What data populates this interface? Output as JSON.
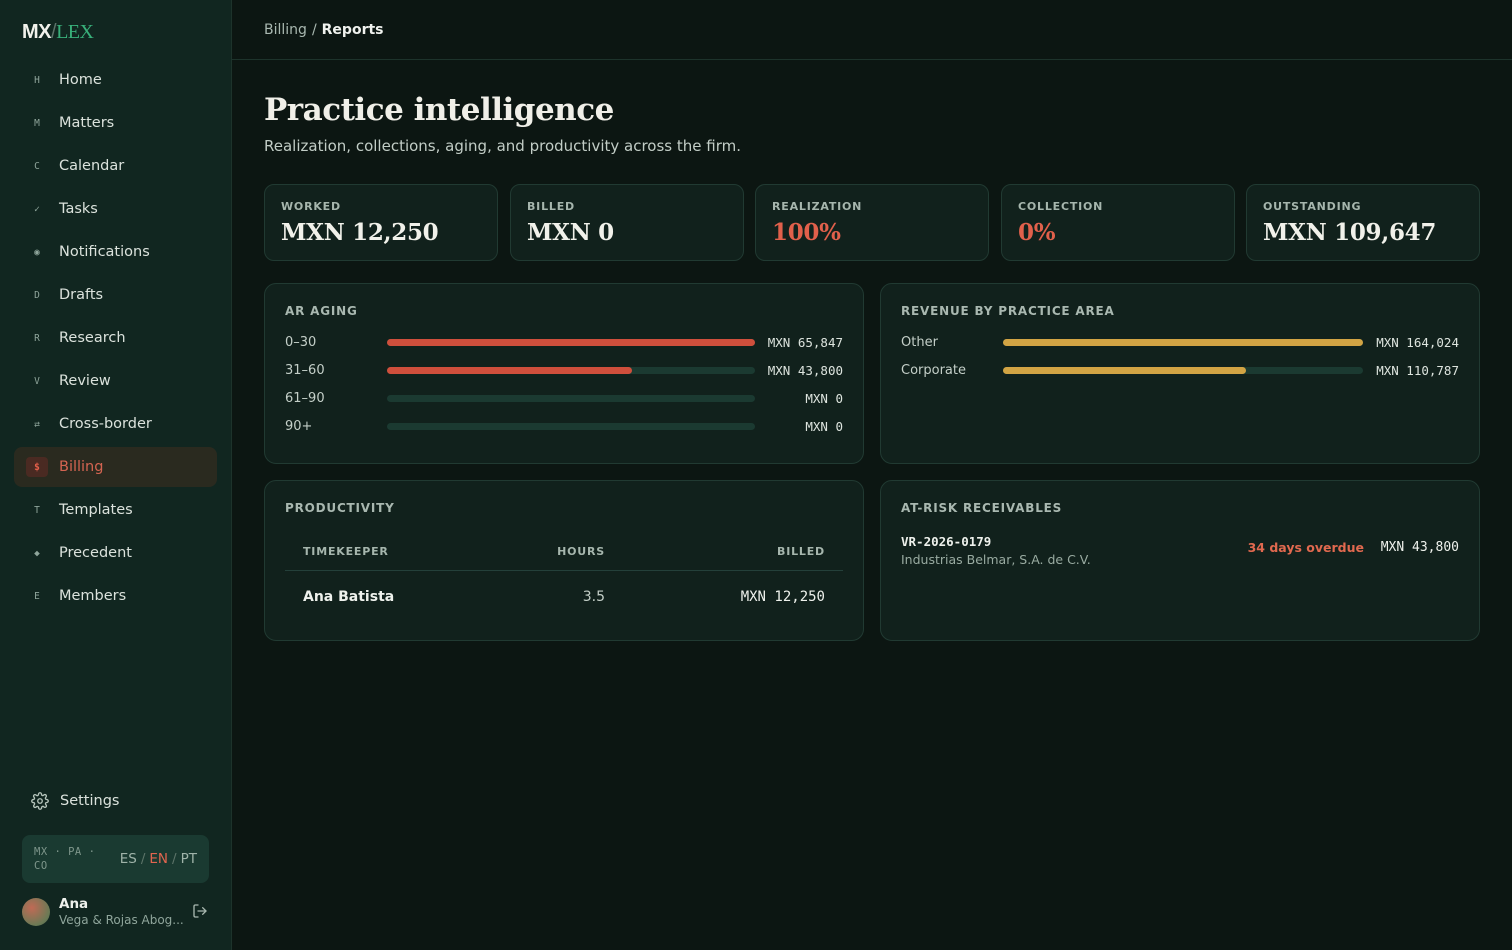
{
  "brand": {
    "mx": "MX",
    "slash": "/",
    "lex": "LEX"
  },
  "nav": [
    {
      "glyph": "H",
      "label": "Home",
      "icon": "home-icon"
    },
    {
      "glyph": "M",
      "label": "Matters",
      "icon": "matters-icon"
    },
    {
      "glyph": "C",
      "label": "Calendar",
      "icon": "calendar-icon"
    },
    {
      "glyph": "✓",
      "label": "Tasks",
      "icon": "check-icon"
    },
    {
      "glyph": "◉",
      "label": "Notifications",
      "icon": "bell-icon"
    },
    {
      "glyph": "D",
      "label": "Drafts",
      "icon": "drafts-icon"
    },
    {
      "glyph": "R",
      "label": "Research",
      "icon": "research-icon"
    },
    {
      "glyph": "V",
      "label": "Review",
      "icon": "review-icon"
    },
    {
      "glyph": "⇄",
      "label": "Cross-border",
      "icon": "swap-icon"
    },
    {
      "glyph": "$",
      "label": "Billing",
      "icon": "dollar-icon",
      "active": true
    },
    {
      "glyph": "T",
      "label": "Templates",
      "icon": "templates-icon"
    },
    {
      "glyph": "◆",
      "label": "Precedent",
      "icon": "diamond-icon"
    },
    {
      "glyph": "E",
      "label": "Members",
      "icon": "members-icon"
    }
  ],
  "settings": {
    "label": "Settings"
  },
  "locale": {
    "regions": "MX · PA · CO",
    "es": "ES",
    "en": "EN",
    "pt": "PT",
    "sep": "/",
    "active": "EN"
  },
  "user": {
    "name": "Ana",
    "org": "Vega & Rojas Abog..."
  },
  "breadcrumb": {
    "parent": "Billing",
    "sep": "/",
    "current": "Reports"
  },
  "page": {
    "title": "Practice intelligence",
    "subtitle": "Realization, collections, aging, and productivity across the firm."
  },
  "kpis": [
    {
      "label": "WORKED",
      "value": "MXN 12,250",
      "alert": false
    },
    {
      "label": "BILLED",
      "value": "MXN 0",
      "alert": false
    },
    {
      "label": "REALIZATION",
      "value": "100%",
      "alert": true
    },
    {
      "label": "COLLECTION",
      "value": "0%",
      "alert": true
    },
    {
      "label": "OUTSTANDING",
      "value": "MXN 109,647",
      "alert": false
    }
  ],
  "colors": {
    "accent_red": "#cf4f3c",
    "accent_gold": "#d2a444",
    "accent_green": "#38b07a"
  },
  "ar_aging": {
    "title": "AR AGING",
    "rows": [
      {
        "label": "0–30",
        "amount": "MXN 65,847",
        "fraction": 1.0
      },
      {
        "label": "31–60",
        "amount": "MXN 43,800",
        "fraction": 0.665
      },
      {
        "label": "61–90",
        "amount": "MXN 0",
        "fraction": 0
      },
      {
        "label": "90+",
        "amount": "MXN 0",
        "fraction": 0
      }
    ]
  },
  "revenue": {
    "title": "REVENUE BY PRACTICE AREA",
    "rows": [
      {
        "label": "Other",
        "amount": "MXN 164,024",
        "fraction": 1.0
      },
      {
        "label": "Corporate",
        "amount": "MXN 110,787",
        "fraction": 0.675
      }
    ]
  },
  "productivity": {
    "title": "PRODUCTIVITY",
    "headers": {
      "timekeeper": "TIMEKEEPER",
      "hours": "HOURS",
      "billed": "BILLED"
    },
    "rows": [
      {
        "timekeeper": "Ana Batista",
        "hours": "3.5",
        "billed": "MXN 12,250"
      }
    ]
  },
  "at_risk": {
    "title": "AT-RISK RECEIVABLES",
    "items": [
      {
        "id": "VR-2026-0179",
        "client": "Industrias Belmar, S.A. de C.V.",
        "status": "34 days overdue",
        "amount": "MXN 43,800"
      }
    ]
  }
}
